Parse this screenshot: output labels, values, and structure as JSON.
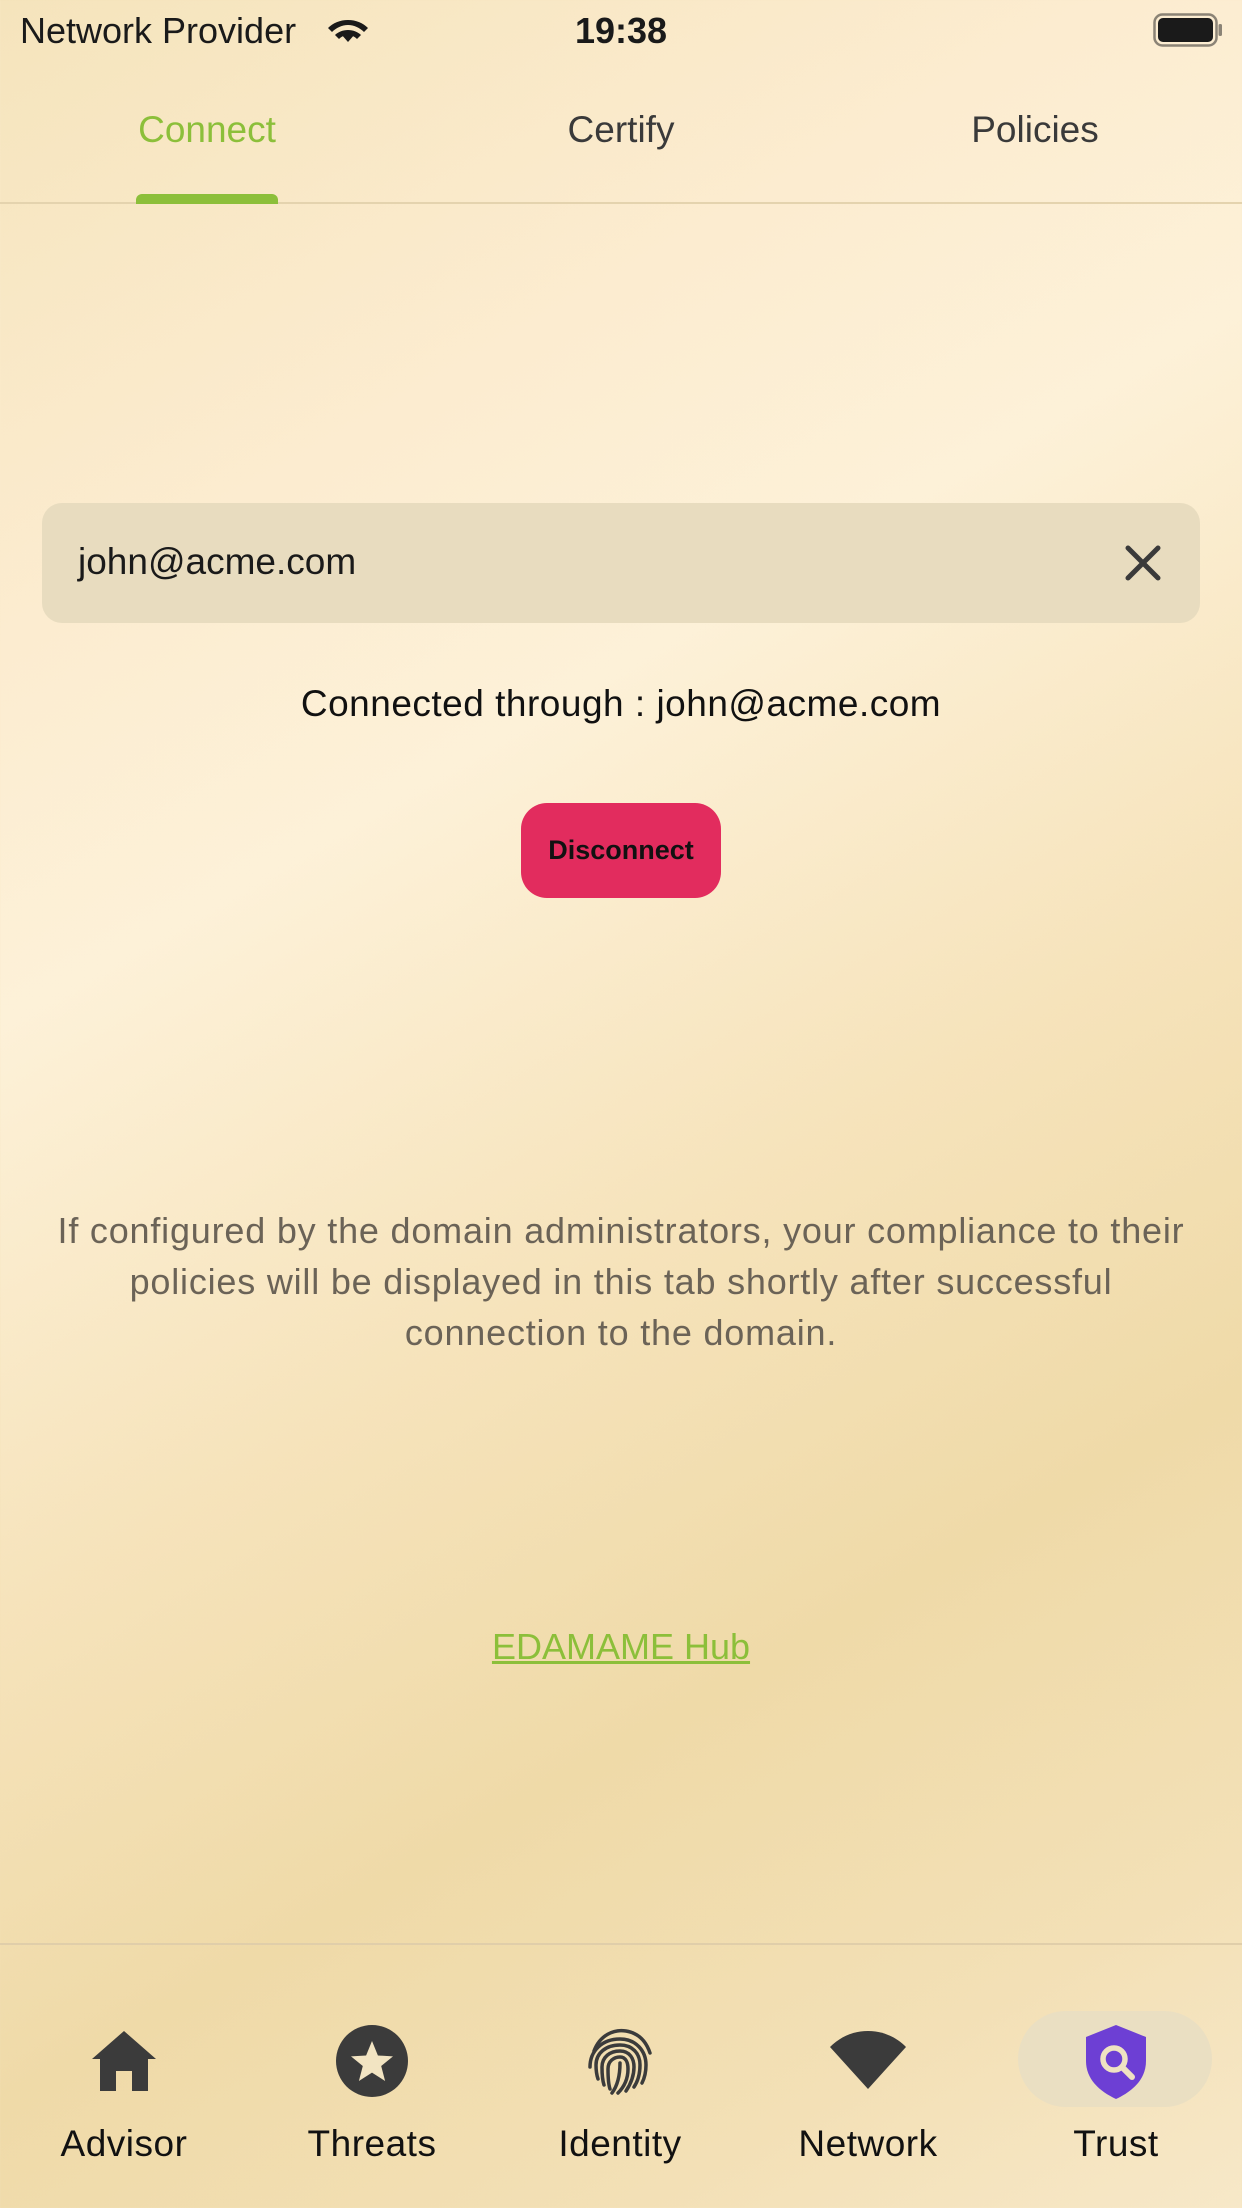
{
  "status_bar": {
    "carrier": "Network Provider",
    "time": "19:38",
    "wifi_icon": "wifi-icon",
    "battery_icon": "battery-full-icon"
  },
  "tabs": [
    {
      "label": "Connect",
      "active": true
    },
    {
      "label": "Certify",
      "active": false
    },
    {
      "label": "Policies",
      "active": false
    }
  ],
  "email_field": {
    "value": "john@acme.com",
    "clear_icon": "close-icon"
  },
  "connected_text": "Connected through : john@acme.com",
  "disconnect_label": "Disconnect",
  "info_lines": [
    "If configured by the domain administrators, your compliance to their",
    "policies will be displayed in this tab shortly after successful",
    "connection to the domain."
  ],
  "hub_link": "EDAMAME Hub",
  "bottom_nav": [
    {
      "label": "Advisor",
      "icon": "home-icon",
      "active": false
    },
    {
      "label": "Threats",
      "icon": "star-badge-icon",
      "active": false
    },
    {
      "label": "Identity",
      "icon": "fingerprint-icon",
      "active": false
    },
    {
      "label": "Network",
      "icon": "wifi-icon",
      "active": false
    },
    {
      "label": "Trust",
      "icon": "shield-search-icon",
      "active": true
    }
  ],
  "colors": {
    "accent": "#8cbf3a",
    "disconnect": "#e22c5e",
    "trust_icon": "#6d3fd4"
  }
}
